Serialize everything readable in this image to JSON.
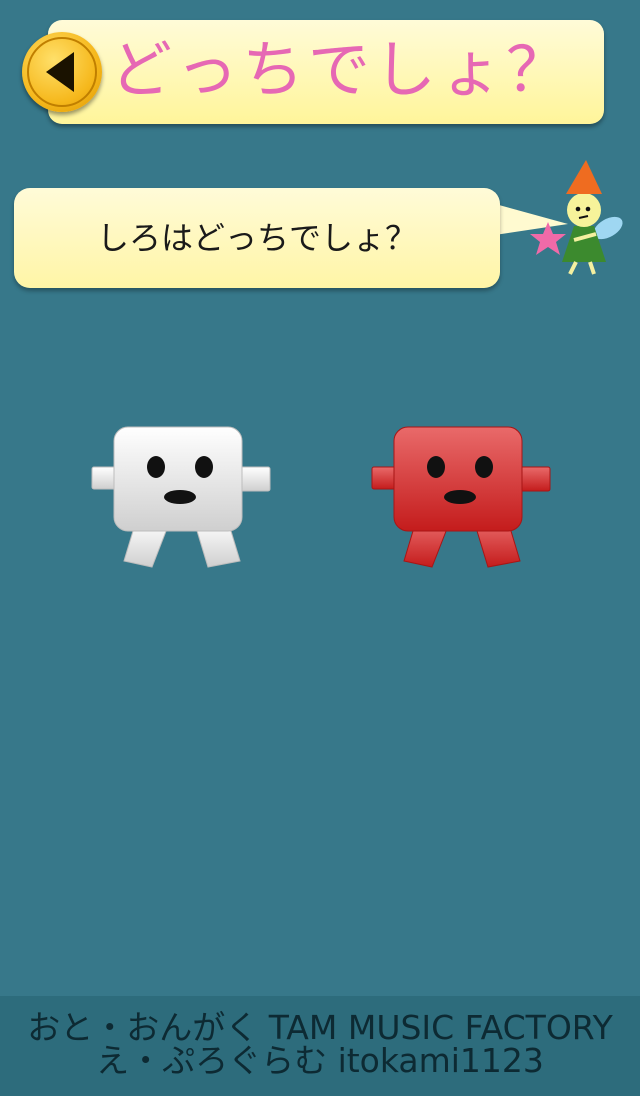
{
  "header": {
    "title": "どっちでしょ？",
    "back_icon": "back-arrow-icon"
  },
  "prompt": {
    "text": "しろはどっちでしょ？"
  },
  "choices": [
    {
      "name": "white",
      "color": "#ffffff",
      "shade": "#cfcfcf"
    },
    {
      "name": "red",
      "color": "#e25a5a",
      "shade": "#c41c1c"
    }
  ],
  "credits": {
    "line1": "おと・おんがく TAM MUSIC FACTORY",
    "line2": "え・ぷろぐらむ itokami1123"
  },
  "colors": {
    "background": "#37788a",
    "title_text": "#e668b4",
    "panel": "#fff59a",
    "button": "#f6b81c"
  }
}
